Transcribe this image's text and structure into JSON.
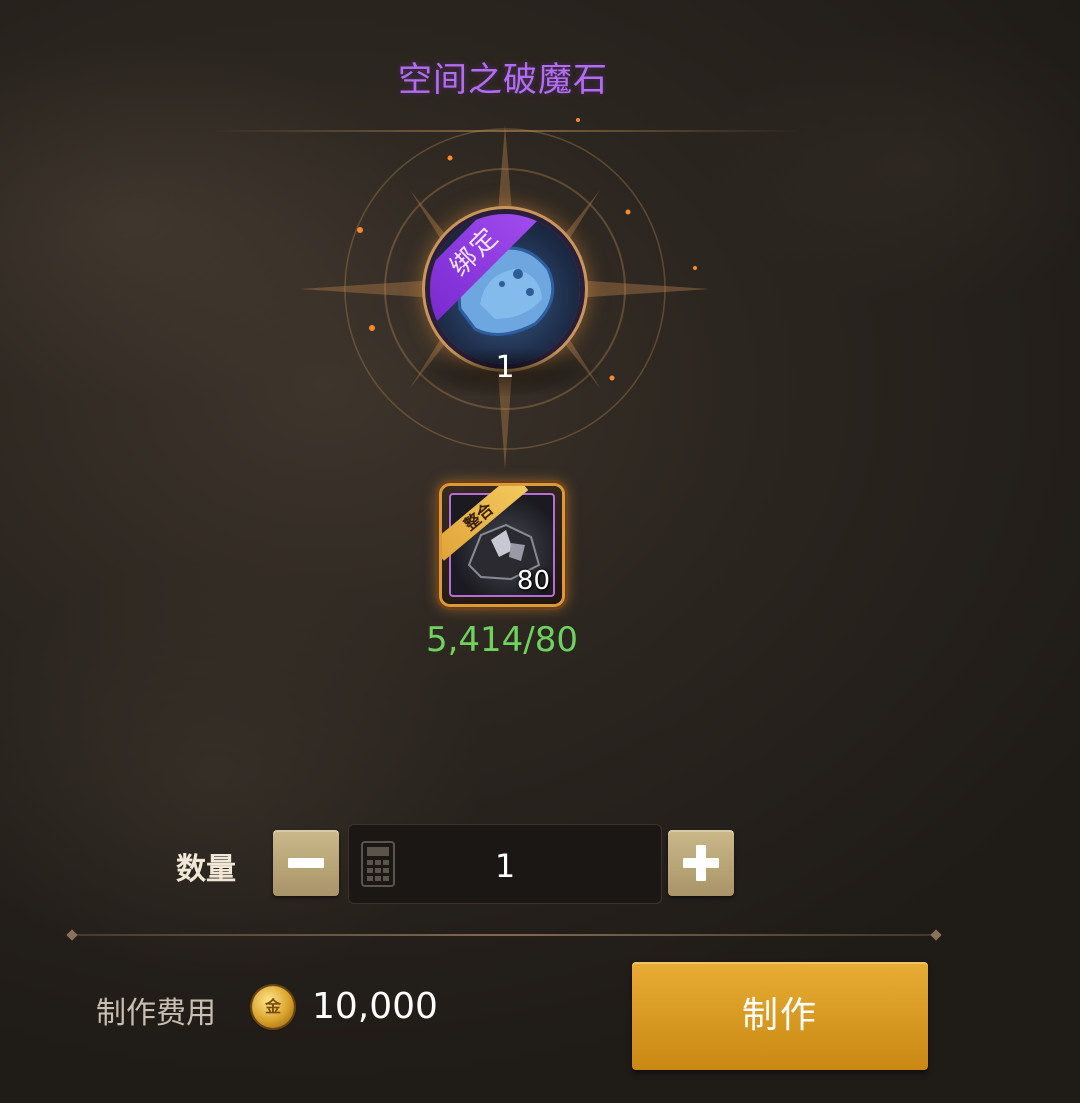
{
  "item": {
    "name": "空间之破魔石",
    "bound_label": "绑定",
    "result_count": "1",
    "icon": "blue-stone-icon"
  },
  "material": {
    "tag": "整合",
    "required_qty": "80",
    "progress": "5,414/80",
    "icon": "dark-ore-icon"
  },
  "quantity": {
    "label": "数量",
    "value": "1",
    "minus_icon": "minus-icon",
    "plus_icon": "plus-icon",
    "calculator_icon": "calculator-icon"
  },
  "cost": {
    "label": "制作费用",
    "currency_icon": "gold-coin-icon",
    "currency_glyph": "金",
    "value": "10,000"
  },
  "actions": {
    "craft_label": "制作"
  },
  "colors": {
    "title_purple": "#b36df2",
    "progress_green": "#6fd15e",
    "craft_gold": "#d99a22"
  }
}
